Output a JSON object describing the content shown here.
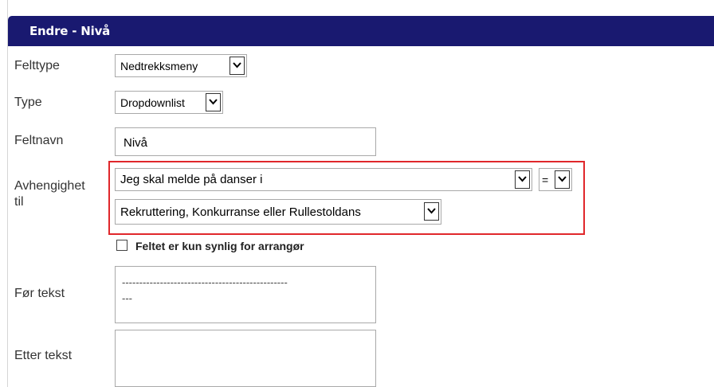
{
  "dialog": {
    "title": "Endre - Nivå"
  },
  "fields": {
    "felttype": {
      "label": "Felttype",
      "value": "Nedtrekksmeny"
    },
    "type": {
      "label": "Type",
      "value": "Dropdownlist"
    },
    "feltnavn": {
      "label": "Feltnavn",
      "value": "Nivå"
    },
    "avhengighet": {
      "label_line1": "Avhengighet",
      "label_line2": "til",
      "field_value": "Jeg skal melde på danser i",
      "operator_value": "=",
      "option_value": "Rekruttering, Konkurranse eller Rullestoldans"
    },
    "visibility": {
      "label": "Feltet er kun synlig for arrangør",
      "checked": false
    },
    "for_tekst": {
      "label": "Før tekst",
      "line1": "------------------------------------------------",
      "line2": "---"
    },
    "etter_tekst": {
      "label": "Etter tekst",
      "value": ""
    }
  },
  "colors": {
    "header_bg": "#191970",
    "highlight_border": "#e0272b"
  },
  "icons": [
    "chevron-down-icon",
    "checkbox-icon"
  ]
}
